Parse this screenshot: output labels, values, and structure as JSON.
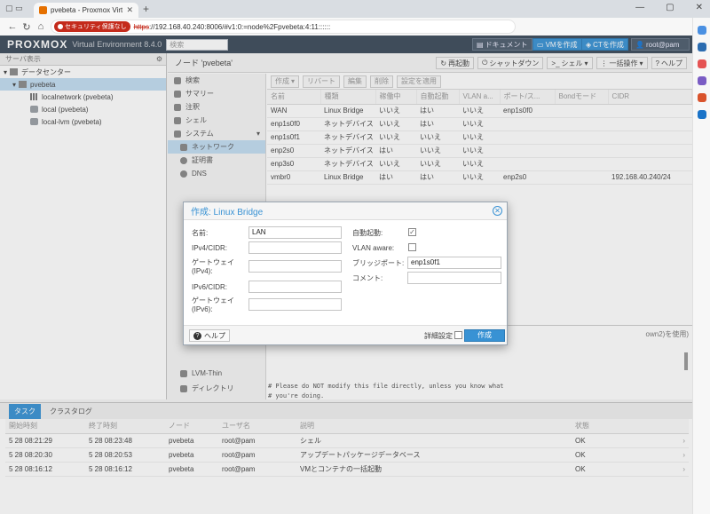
{
  "browser": {
    "tab_title": "pvebeta - Proxmox Virtual Environm",
    "security_badge": "セキュリティ保護なし",
    "url_https": "https",
    "url_rest": "://192.168.40.240:8006/#v1:0:=node%2Fpvebeta:4:11::::::"
  },
  "header": {
    "logo_text": "PROXMOX",
    "ve_label": "Virtual Environment 8.4.0",
    "search_placeholder": "検索",
    "docs_label": "ドキュメント",
    "create_vm_label": "VMを作成",
    "create_ct_label": "CTを作成",
    "user_label": "root@pam"
  },
  "tree": {
    "view_label": "サーバ表示",
    "items": [
      {
        "label": "データセンター"
      },
      {
        "label": "pvebeta"
      },
      {
        "label": "localnetwork (pvebeta)"
      },
      {
        "label": "local (pvebeta)"
      },
      {
        "label": "local-lvm (pvebeta)"
      }
    ]
  },
  "node_header": {
    "title": "ノード 'pvebeta'",
    "reboot": "再起動",
    "shutdown": "シャットダウン",
    "shell": "シェル",
    "bulk": "一括操作",
    "help": "ヘルプ"
  },
  "submenu": {
    "items": [
      "検索",
      "サマリー",
      "注釈",
      "シェル",
      "システム",
      "ネットワーク",
      "証明書",
      "DNS"
    ],
    "lower_items": [
      "LVM-Thin",
      "ディレクトリ"
    ]
  },
  "toolbar": {
    "create": "作成",
    "revert": "リバート",
    "edit": "編集",
    "delete": "削除",
    "apply": "設定を適用"
  },
  "network_table": {
    "headers": [
      "名前",
      "種類",
      "稼働中",
      "自動起動",
      "VLAN a...",
      "ポート/ス...",
      "Bondモード",
      "CIDR"
    ],
    "rows": [
      [
        "WAN",
        "Linux Bridge",
        "いいえ",
        "はい",
        "いいえ",
        "enp1s0f0",
        "",
        ""
      ],
      [
        "enp1s0f0",
        "ネットデバイス",
        "いいえ",
        "はい",
        "いいえ",
        "",
        "",
        ""
      ],
      [
        "enp1s0f1",
        "ネットデバイス",
        "いいえ",
        "いいえ",
        "いいえ",
        "",
        "",
        ""
      ],
      [
        "enp2s0",
        "ネットデバイス",
        "はい",
        "いいえ",
        "いいえ",
        "",
        "",
        ""
      ],
      [
        "enp3s0",
        "ネットデバイス",
        "いいえ",
        "いいえ",
        "いいえ",
        "",
        "",
        ""
      ],
      [
        "vmbr0",
        "Linux Bridge",
        "はい",
        "はい",
        "いいえ",
        "enp2s0",
        "",
        "192.168.40.240/24"
      ]
    ]
  },
  "pending": {
    "note": "own2)を使用)",
    "code": "# Please do NOT modify this file directly, unless you know what\n# you're doing.\n#\n# If you want to manage parts of the network configuration manually,\n# please utilize the 'source' or 'source-directory' directives to do\n# so."
  },
  "dialog": {
    "title": "作成: Linux Bridge",
    "name_label": "名前:",
    "name_value": "LAN",
    "ipv4_label": "IPv4/CIDR:",
    "gw4_label": "ゲートウェイ (IPv4):",
    "ipv6_label": "IPv6/CIDR:",
    "gw6_label": "ゲートウェイ (IPv6):",
    "autostart_label": "自動起動:",
    "vlan_label": "VLAN aware:",
    "ports_label": "ブリッジポート:",
    "ports_value": "enp1s0f1",
    "comment_label": "コメント:",
    "help_label": "ヘルプ",
    "advanced_label": "詳細設定",
    "create_label": "作成"
  },
  "bottom": {
    "tab_tasks": "タスク",
    "tab_cluster": "クラスタログ",
    "headers": [
      "開始時刻",
      "終了時刻",
      "ノード",
      "ユーザ名",
      "説明",
      "状態"
    ],
    "rows": [
      [
        "5 28 08:21:29",
        "5 28 08:23:48",
        "pvebeta",
        "root@pam",
        "シェル",
        "OK"
      ],
      [
        "5 28 08:20:30",
        "5 28 08:20:53",
        "pvebeta",
        "root@pam",
        "アップデートパッケージデータベース",
        "OK"
      ],
      [
        "5 28 08:16:12",
        "5 28 08:16:12",
        "pvebeta",
        "root@pam",
        "VMとコンテナの一括起動",
        "OK"
      ]
    ]
  },
  "colors": {
    "accent": "#3892d4",
    "header_bg": "#3c4a5a",
    "brand_orange": "#e57000",
    "warning_red": "#c42b1c"
  }
}
